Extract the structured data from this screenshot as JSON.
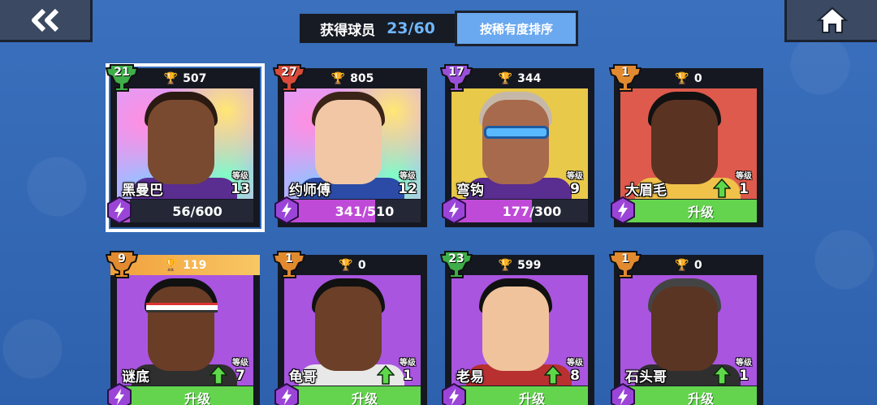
{
  "header": {
    "back_icon": "double-chevron-left-icon",
    "home_icon": "home-icon",
    "collected_label": "获得球员",
    "collected_count": "23/60",
    "sort_button": "按稀有度排序"
  },
  "level_label": "等级",
  "colors": {
    "background": "#2f63b0",
    "progress_fill": "#c04ad8",
    "upgrade_green": "#64d44e",
    "trophy_gold": "#f6c737"
  },
  "cards": [
    {
      "name": "黑曼巴",
      "rank": "21",
      "trophies": "507",
      "level": "13",
      "progress": "56/600",
      "progress_fraction": 0.093,
      "badge_color": "#3fae4a",
      "bg": "holo",
      "selected": true,
      "upgrade": false
    },
    {
      "name": "约师傅",
      "rank": "27",
      "trophies": "805",
      "level": "12",
      "progress": "341/510",
      "progress_fraction": 0.669,
      "badge_color": "#d84a3a",
      "bg": "holo",
      "selected": false,
      "upgrade": false
    },
    {
      "name": "弯钩",
      "rank": "17",
      "trophies": "344",
      "level": "9",
      "progress": "177/300",
      "progress_fraction": 0.59,
      "badge_color": "#9a4fd8",
      "bg": "yellow",
      "selected": false,
      "upgrade": false
    },
    {
      "name": "大眉毛",
      "rank": "1",
      "trophies": "0",
      "level": "1",
      "upgrade_label": "升级",
      "badge_color": "#e18a2f",
      "bg": "red",
      "selected": false,
      "upgrade": true
    },
    {
      "name": "谜底",
      "rank": "9",
      "trophies": "119",
      "level": "7",
      "upgrade_label": "升级",
      "badge_color": "#e18a2f",
      "bg": "purple",
      "selected": false,
      "upgrade": true,
      "highlight_top": true
    },
    {
      "name": "龟哥",
      "rank": "1",
      "trophies": "0",
      "level": "1",
      "upgrade_label": "升级",
      "badge_color": "#e18a2f",
      "bg": "purple",
      "selected": false,
      "upgrade": true
    },
    {
      "name": "老易",
      "rank": "23",
      "trophies": "599",
      "level": "8",
      "upgrade_label": "升级",
      "badge_color": "#3fae4a",
      "bg": "purple",
      "selected": false,
      "upgrade": true
    },
    {
      "name": "石头哥",
      "rank": "1",
      "trophies": "0",
      "level": "1",
      "upgrade_label": "升级",
      "badge_color": "#e18a2f",
      "bg": "purple",
      "selected": false,
      "upgrade": true
    }
  ]
}
